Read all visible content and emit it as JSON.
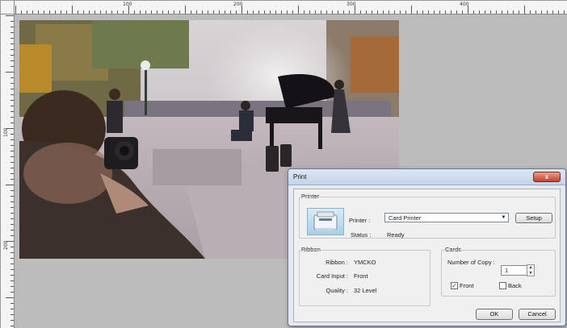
{
  "ruler": {
    "h_numbers": [
      "100",
      "200",
      "300",
      "400"
    ],
    "v_numbers": [
      "100",
      "200"
    ]
  },
  "dialog": {
    "title": "Print",
    "close_label": "x",
    "printer_group": {
      "label": "Printer",
      "printer_label": "Printer :",
      "printer_value": "Card Printer",
      "setup_label": "Setup",
      "status_label": "Status :",
      "status_value": "Ready"
    },
    "ribbon_group": {
      "label": "Ribbon",
      "ribbon_label": "Ribbon :",
      "ribbon_value": "YMCKO",
      "card_input_label": "Card Input :",
      "card_input_value": "Front",
      "quality_label": "Quality :",
      "quality_value": "32 Level"
    },
    "cards_group": {
      "label": "Cards",
      "copies_label": "Number of Copy :",
      "copies_value": "1",
      "front_label": "Front",
      "front_checked": true,
      "back_label": "Back",
      "back_checked": false
    },
    "ok_label": "OK",
    "cancel_label": "Cancel"
  },
  "colors": {
    "accent": "#c8402a",
    "titlebar": "#c4d4e8",
    "canvas": "#bcbcbc"
  }
}
